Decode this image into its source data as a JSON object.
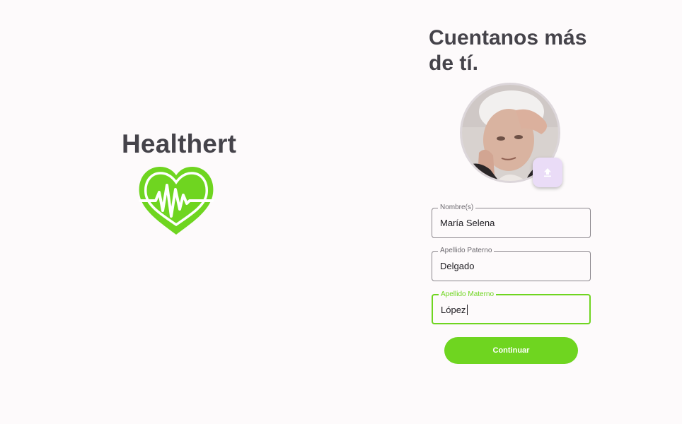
{
  "brand": {
    "name": "Healthert",
    "logo_icon": "heart-pulse-icon",
    "logo_color": "#6fd520"
  },
  "form": {
    "title": "Cuentanos más de tí.",
    "avatar_icon": "profile-photo",
    "upload_icon": "upload-icon",
    "fields": [
      {
        "label": "Nombre(s)",
        "value": "María Selena"
      },
      {
        "label": "Apellido Paterno",
        "value": "Delgado"
      },
      {
        "label": "Apellido Materno",
        "value": "López"
      }
    ],
    "continue_label": "Continuar",
    "accent_color": "#6fd520"
  }
}
